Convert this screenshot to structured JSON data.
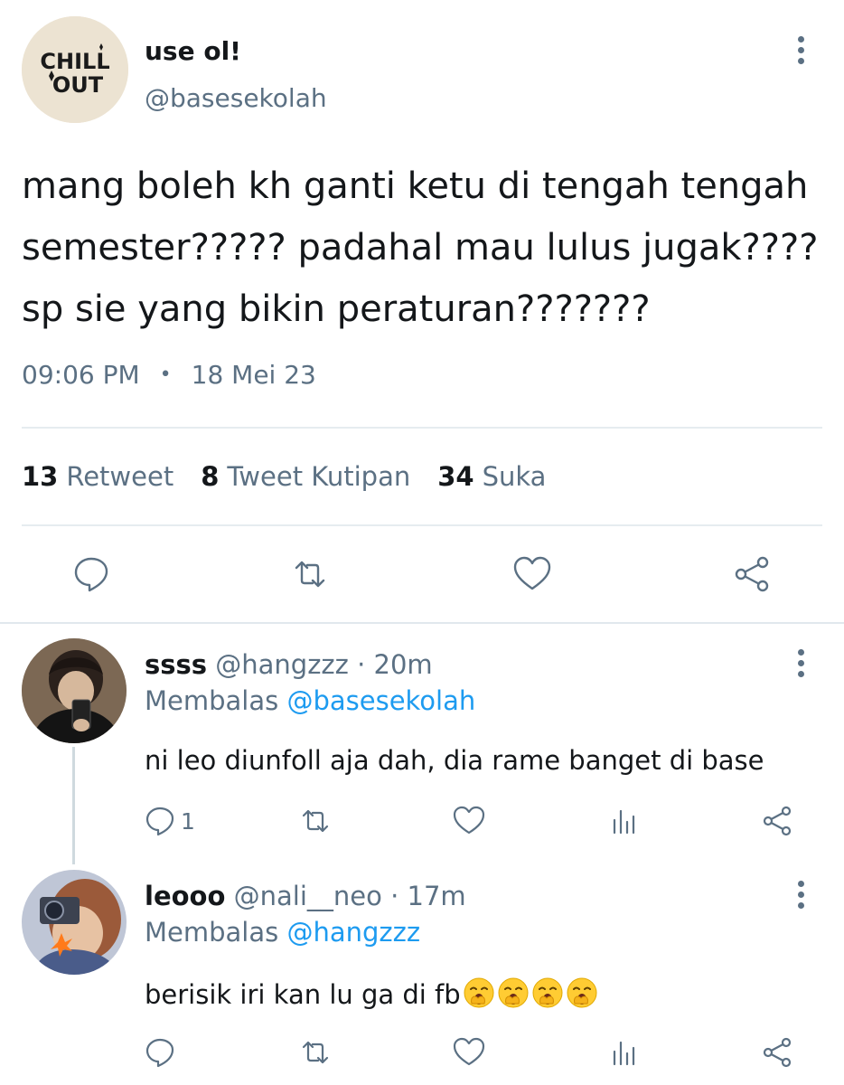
{
  "main_tweet": {
    "avatar_text_top": "CHILL",
    "avatar_text_bottom": "OUT",
    "display_name": "use ol!",
    "handle": "@basesekolah",
    "text_lines": [
      "mang boleh kh ganti ketu di tengah tengah",
      "semester????? padahal mau lulus jugak????",
      "sp sie yang bikin peraturan???????"
    ],
    "time": "09:06 PM",
    "separator": "•",
    "date": "18 Mei 23",
    "stats": [
      {
        "count": "13",
        "label": "Retweet"
      },
      {
        "count": "8",
        "label": "Tweet Kutipan"
      },
      {
        "count": "34",
        "label": "Suka"
      }
    ],
    "actions": [
      "reply-icon",
      "retweet-icon",
      "like-icon",
      "share-icon"
    ]
  },
  "replies": [
    {
      "name": "ssss",
      "handle": "@hangzzz",
      "separator": "·",
      "time": "20m",
      "replying_prefix": "Membalas",
      "replying_to": "@basesekolah",
      "text": "ni leo diunfoll aja dah, dia rame banget di base",
      "emoji": "",
      "reply_count": "1",
      "actions": [
        "reply-icon",
        "retweet-icon",
        "like-icon",
        "analytics-icon",
        "share-icon"
      ]
    },
    {
      "name": "leooo",
      "handle": "@nali__neo",
      "separator": "·",
      "time": "17m",
      "replying_prefix": "Membalas",
      "replying_to": "@hangzzz",
      "text": "berisik iri kan lu ga di fb",
      "emoji": "yawning-face-emoji x4",
      "reply_count": "",
      "actions": [
        "reply-icon",
        "retweet-icon",
        "like-icon",
        "analytics-icon",
        "share-icon"
      ]
    }
  ],
  "colors": {
    "text": "#14171a",
    "secondary": "#5b7083",
    "link": "#1d9bf0",
    "divider": "#e6ecf0"
  }
}
